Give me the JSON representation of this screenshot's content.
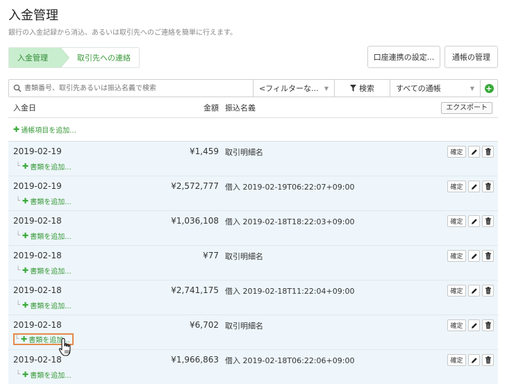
{
  "header": {
    "title": "入金管理",
    "subtitle": "銀行の入金記録から消込、あるいは取引先へのご連絡を簡単に行えます。"
  },
  "steps": [
    {
      "label": "入金管理",
      "active": true
    },
    {
      "label": "取引先への連絡",
      "active": false
    }
  ],
  "toolbar": {
    "account_settings": "口座連携の設定...",
    "ledger_manage": "通帳の管理"
  },
  "search": {
    "placeholder": "書類番号、取引先あるいは振込名義で検索",
    "filter": "<フィルターな...",
    "search_button": "検索",
    "ledger_select": "すべての通帳"
  },
  "table": {
    "col_date": "入金日",
    "col_amount": "金額",
    "col_name": "振込名義",
    "export": "エクスポート",
    "add_ledger_item": "通帳項目を追加...",
    "add_document": "書類を追加...",
    "confirm_label": "確定",
    "rows": [
      {
        "date": "2019-02-19",
        "amount": "¥1,459",
        "name": "取引明細名"
      },
      {
        "date": "2019-02-19",
        "amount": "¥2,572,777",
        "name": "借入 2019-02-19T06:22:07+09:00"
      },
      {
        "date": "2019-02-18",
        "amount": "¥1,036,108",
        "name": "借入 2019-02-18T18:22:03+09:00"
      },
      {
        "date": "2019-02-18",
        "amount": "¥77",
        "name": "取引明細名"
      },
      {
        "date": "2019-02-18",
        "amount": "¥2,741,175",
        "name": "借入 2019-02-18T11:22:04+09:00"
      },
      {
        "date": "2019-02-18",
        "amount": "¥6,702",
        "name": "取引明細名"
      },
      {
        "date": "2019-02-18",
        "amount": "¥1,966,863",
        "name": "借入 2019-02-18T06:22:06+09:00"
      }
    ]
  },
  "colors": {
    "accent_green": "#3aaa3a",
    "step_active_bg": "#c9eecf",
    "row_bg": "#eef6fb",
    "highlight": "#e58a4a"
  }
}
